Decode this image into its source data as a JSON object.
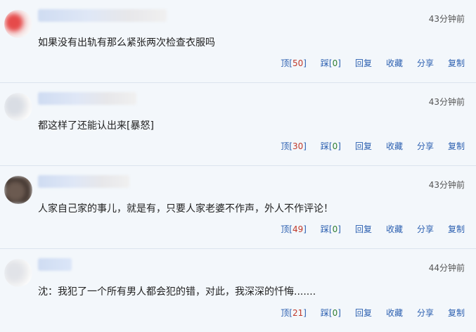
{
  "comments": [
    {
      "time": "43分钟前",
      "text": "如果没有出轨有那么紧张两次检查衣服吗",
      "actions": {
        "up_label": "顶",
        "up_count": "50",
        "down_label": "踩",
        "down_count": "0",
        "reply": "回复",
        "fav": "收藏",
        "share": "分享",
        "copy": "复制"
      }
    },
    {
      "time": "43分钟前",
      "text": "都这样了还能认出来[暴怒]",
      "actions": {
        "up_label": "顶",
        "up_count": "30",
        "down_label": "踩",
        "down_count": "0",
        "reply": "回复",
        "fav": "收藏",
        "share": "分享",
        "copy": "复制"
      }
    },
    {
      "time": "43分钟前",
      "text": "人家自己家的事儿，就是有，只要人家老婆不作声，外人不作评论！",
      "actions": {
        "up_label": "顶",
        "up_count": "49",
        "down_label": "踩",
        "down_count": "0",
        "reply": "回复",
        "fav": "收藏",
        "share": "分享",
        "copy": "复制"
      }
    },
    {
      "time": "44分钟前",
      "text": "沈：我犯了一个所有男人都会犯的错，对此，我深深的忏悔.......",
      "actions": {
        "up_label": "顶",
        "up_count": "21",
        "down_label": "踩",
        "down_count": "0",
        "reply": "回复",
        "fav": "收藏",
        "share": "分享",
        "copy": "复制"
      }
    }
  ]
}
